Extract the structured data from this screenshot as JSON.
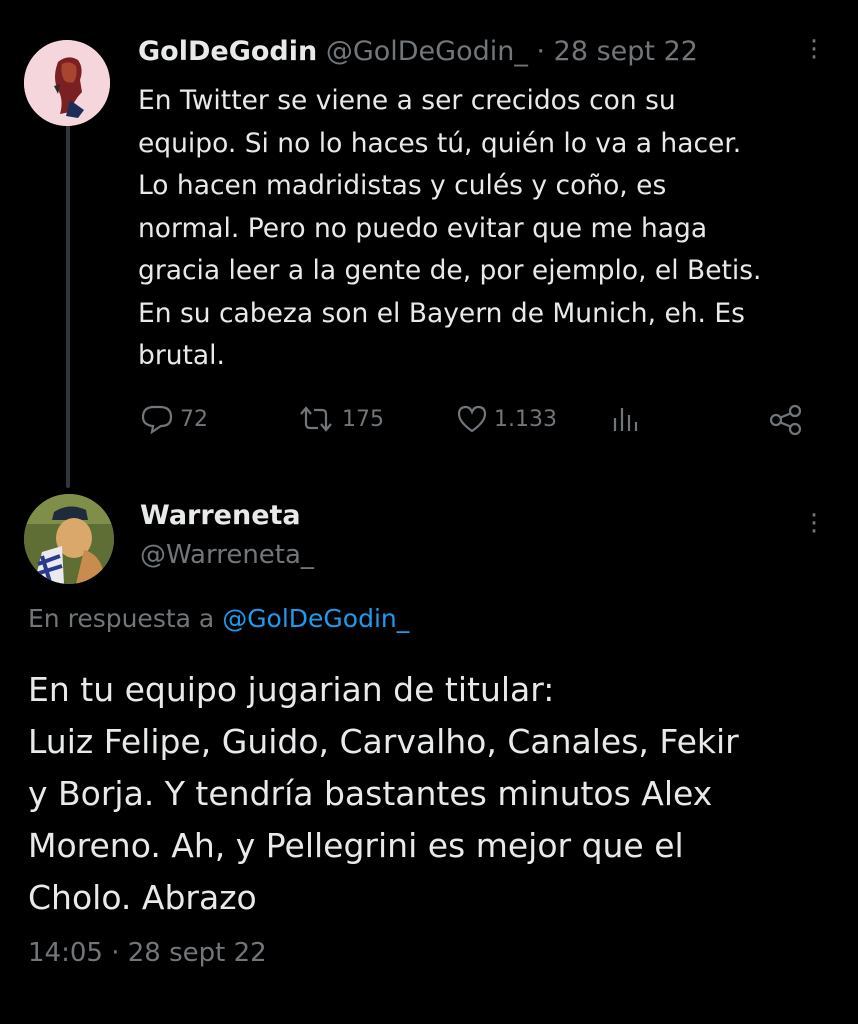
{
  "tweet1": {
    "display_name": "GolDeGodin",
    "handle": "@GolDeGodin_",
    "separator": "·",
    "date": "28 sept 22",
    "lines": [
      "En Twitter se viene a ser crecidos con su",
      "equipo. Si no lo haces tú, quién lo va a hacer.",
      "Lo hacen madridistas y culés y coño, es",
      "normal. Pero no puedo evitar que me haga",
      "gracia leer a la gente de, por ejemplo, el Betis.",
      "En su cabeza son el Bayern de Munich, eh. Es",
      "brutal."
    ],
    "replies": "72",
    "retweets": "175",
    "likes": "1.133",
    "icons": [
      "reply-icon",
      "retweet-icon",
      "like-icon",
      "analytics-icon",
      "share-icon",
      "more-icon"
    ]
  },
  "tweet2": {
    "display_name": "Warreneta",
    "handle": "@Warreneta_",
    "reply_prefix": "En respuesta a",
    "reply_handle": "@GolDeGodin_",
    "lines": [
      "En tu equipo jugarian de titular:",
      "Luiz Felipe, Guido, Carvalho, Canales, Fekir",
      "y Borja. Y tendría bastantes minutos Alex",
      "Moreno. Ah, y Pellegrini es mejor que el",
      "Cholo. Abrazo"
    ],
    "time": "14:05",
    "separator": "·",
    "date": "28 sept 22"
  },
  "colors": {
    "background": "#000000",
    "text": "#e7e9ea",
    "muted": "#71767b",
    "link": "#1d9bf0"
  }
}
